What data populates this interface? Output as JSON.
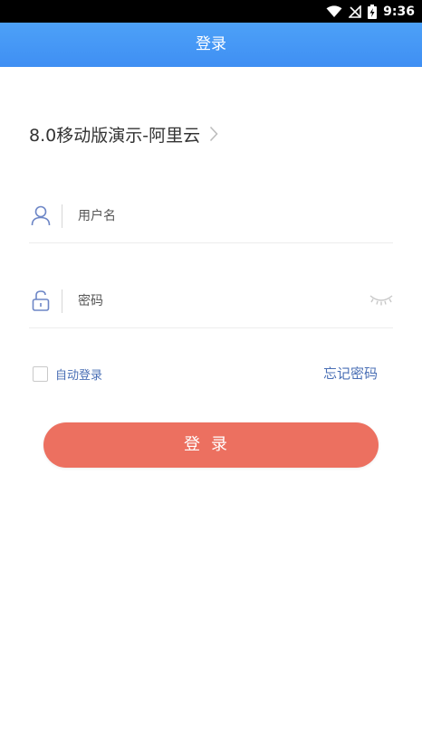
{
  "status_bar": {
    "time": "9:36",
    "icons": [
      "wifi-icon",
      "no-signal-icon",
      "battery-charging-icon"
    ]
  },
  "app_bar": {
    "title": "登录"
  },
  "server": {
    "name": "8.0移动版演示-阿里云"
  },
  "username_field": {
    "placeholder": "用户名",
    "value": "",
    "icon": "user-icon"
  },
  "password_field": {
    "placeholder": "密码",
    "value": "",
    "icon": "lock-icon",
    "toggle_icon": "eye-closed-icon"
  },
  "options": {
    "auto_login_label": "自动登录",
    "auto_login_checked": false,
    "forgot_password": "忘记密码"
  },
  "login_button": {
    "label": "登录"
  },
  "colors": {
    "header_blue": "#4a9af6",
    "login_button": "#ec7060",
    "link_blue": "#4a6fb5",
    "icon_blue": "#6d86c6"
  }
}
